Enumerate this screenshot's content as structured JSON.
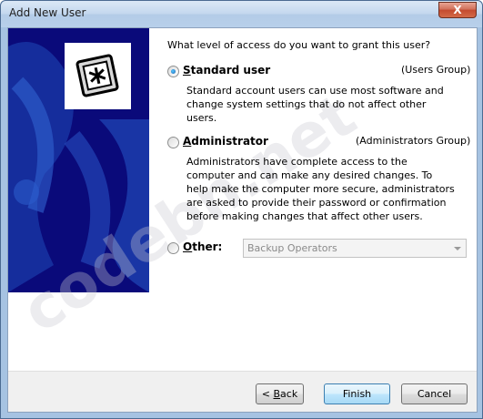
{
  "window": {
    "title": "Add New User",
    "close_label": "X"
  },
  "question": "What level of access do you want to grant this user?",
  "options": [
    {
      "label": "Standard user",
      "mnemonic_index": 0,
      "group": "(Users Group)",
      "checked": true,
      "description": "Standard account users can use most software and change system settings that do not affect other users."
    },
    {
      "label": "Administrator",
      "group": "(Administrators Group)",
      "checked": false,
      "description": "Administrators have complete access to the computer and can make any desired changes. To help make the computer more secure, administrators are asked to provide their password or confirmation before making changes that affect other users."
    },
    {
      "label": "Other:",
      "checked": false,
      "select_value": "Backup Operators"
    }
  ],
  "watermark": "codebn.net",
  "buttons": {
    "back": "< Back",
    "finish": "Finish",
    "cancel": "Cancel"
  },
  "colors": {
    "banner": "#0a0a7a",
    "accent": "#3c7fb1",
    "close": "#c44a2e"
  },
  "icons": {
    "logo": "users-key-icon",
    "dropdown": "chevron-down-icon"
  }
}
